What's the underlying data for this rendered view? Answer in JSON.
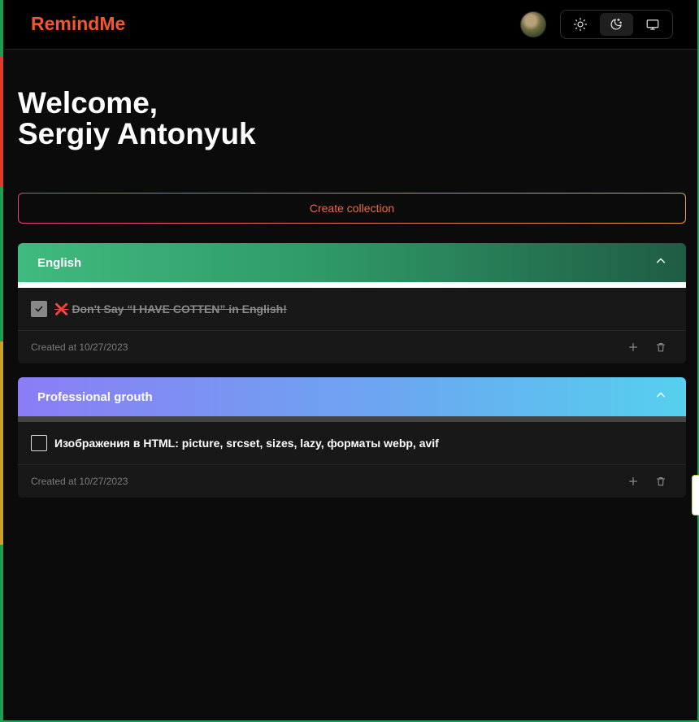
{
  "app": {
    "logo": "RemindMe"
  },
  "theme": {
    "active": "dark",
    "buttons": [
      {
        "name": "light",
        "icon": "sun-icon"
      },
      {
        "name": "dark",
        "icon": "moon-stars-icon"
      },
      {
        "name": "system",
        "icon": "monitor-icon"
      }
    ]
  },
  "user": {
    "avatar": "avatar"
  },
  "welcome": {
    "line1": "Welcome,",
    "line2": "Sergiy Antonyuk"
  },
  "actions": {
    "create_collection": "Create collection"
  },
  "collections": [
    {
      "title": "English",
      "gradient": [
        "#3fb97c",
        "#1e5e45"
      ],
      "progress_color": "#ffffff",
      "progress": 1.0,
      "tasks": [
        {
          "mark": "❌",
          "text": "Don't Say “I HAVE COTTEN” in English!",
          "done": true
        }
      ],
      "created": "Created at 10/27/2023"
    },
    {
      "title": "Professional grouth",
      "gradient": [
        "#8b7cf6",
        "#55cdee"
      ],
      "progress_color": "#444444",
      "progress": 0.0,
      "tasks": [
        {
          "text": "Изображения в HTML: picture, srcset, sizes, lazy, форматы webp, avif",
          "done": false
        }
      ],
      "created": "Created at 10/27/2023"
    }
  ],
  "colors": {
    "accent": "#f0582a",
    "background": "#0b0b0b",
    "card": "#181818"
  }
}
